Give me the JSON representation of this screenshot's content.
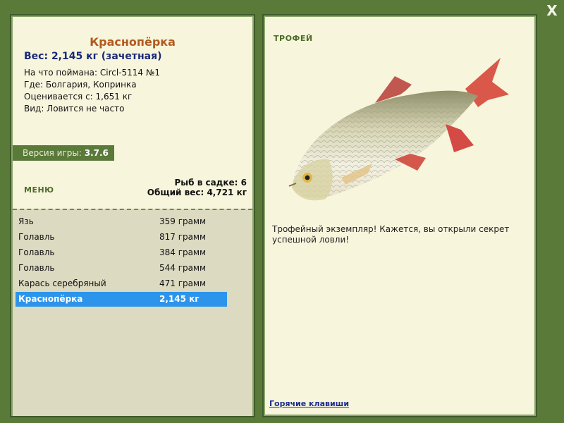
{
  "close_label": "X",
  "fish": {
    "name": "Краснопёрка",
    "weight_line": "Вес: 2,145 кг (зачетная)",
    "caught_on": "На что поймана: Circl-5114 №1",
    "where": "Где: Болгария, Копринка",
    "valued_from": "Оценивается с: 1,651 кг",
    "kind": "Вид: Ловится не часто"
  },
  "version": {
    "label": "Версия игры:",
    "value": "3.7.6"
  },
  "menu_title": "МЕНЮ",
  "keepnet": {
    "count": "Рыб в садке: 6",
    "total": "Общий вес: 4,721 кг"
  },
  "catch_list": [
    {
      "name": "Язь",
      "weight": "359 грамм"
    },
    {
      "name": "Голавль",
      "weight": "817 грамм"
    },
    {
      "name": "Голавль",
      "weight": "384 грамм"
    },
    {
      "name": "Голавль",
      "weight": "544 грамм"
    },
    {
      "name": "Карась серебряный",
      "weight": "471 грамм"
    },
    {
      "name": "Краснопёрка",
      "weight": "2,145 кг"
    }
  ],
  "selected_index": 5,
  "trophy_title": "ТРОФЕЙ",
  "trophy_text": "Трофейный экземпляр! Кажется, вы открыли секрет успешной ловли!",
  "hotkeys_label": "Горячие клавиши",
  "colors": {
    "frame": "#5a7a3a",
    "panel": "#f7f5dc",
    "title": "#b35a1f",
    "selected": "#2c94ea",
    "weight": "#1a2a78"
  }
}
